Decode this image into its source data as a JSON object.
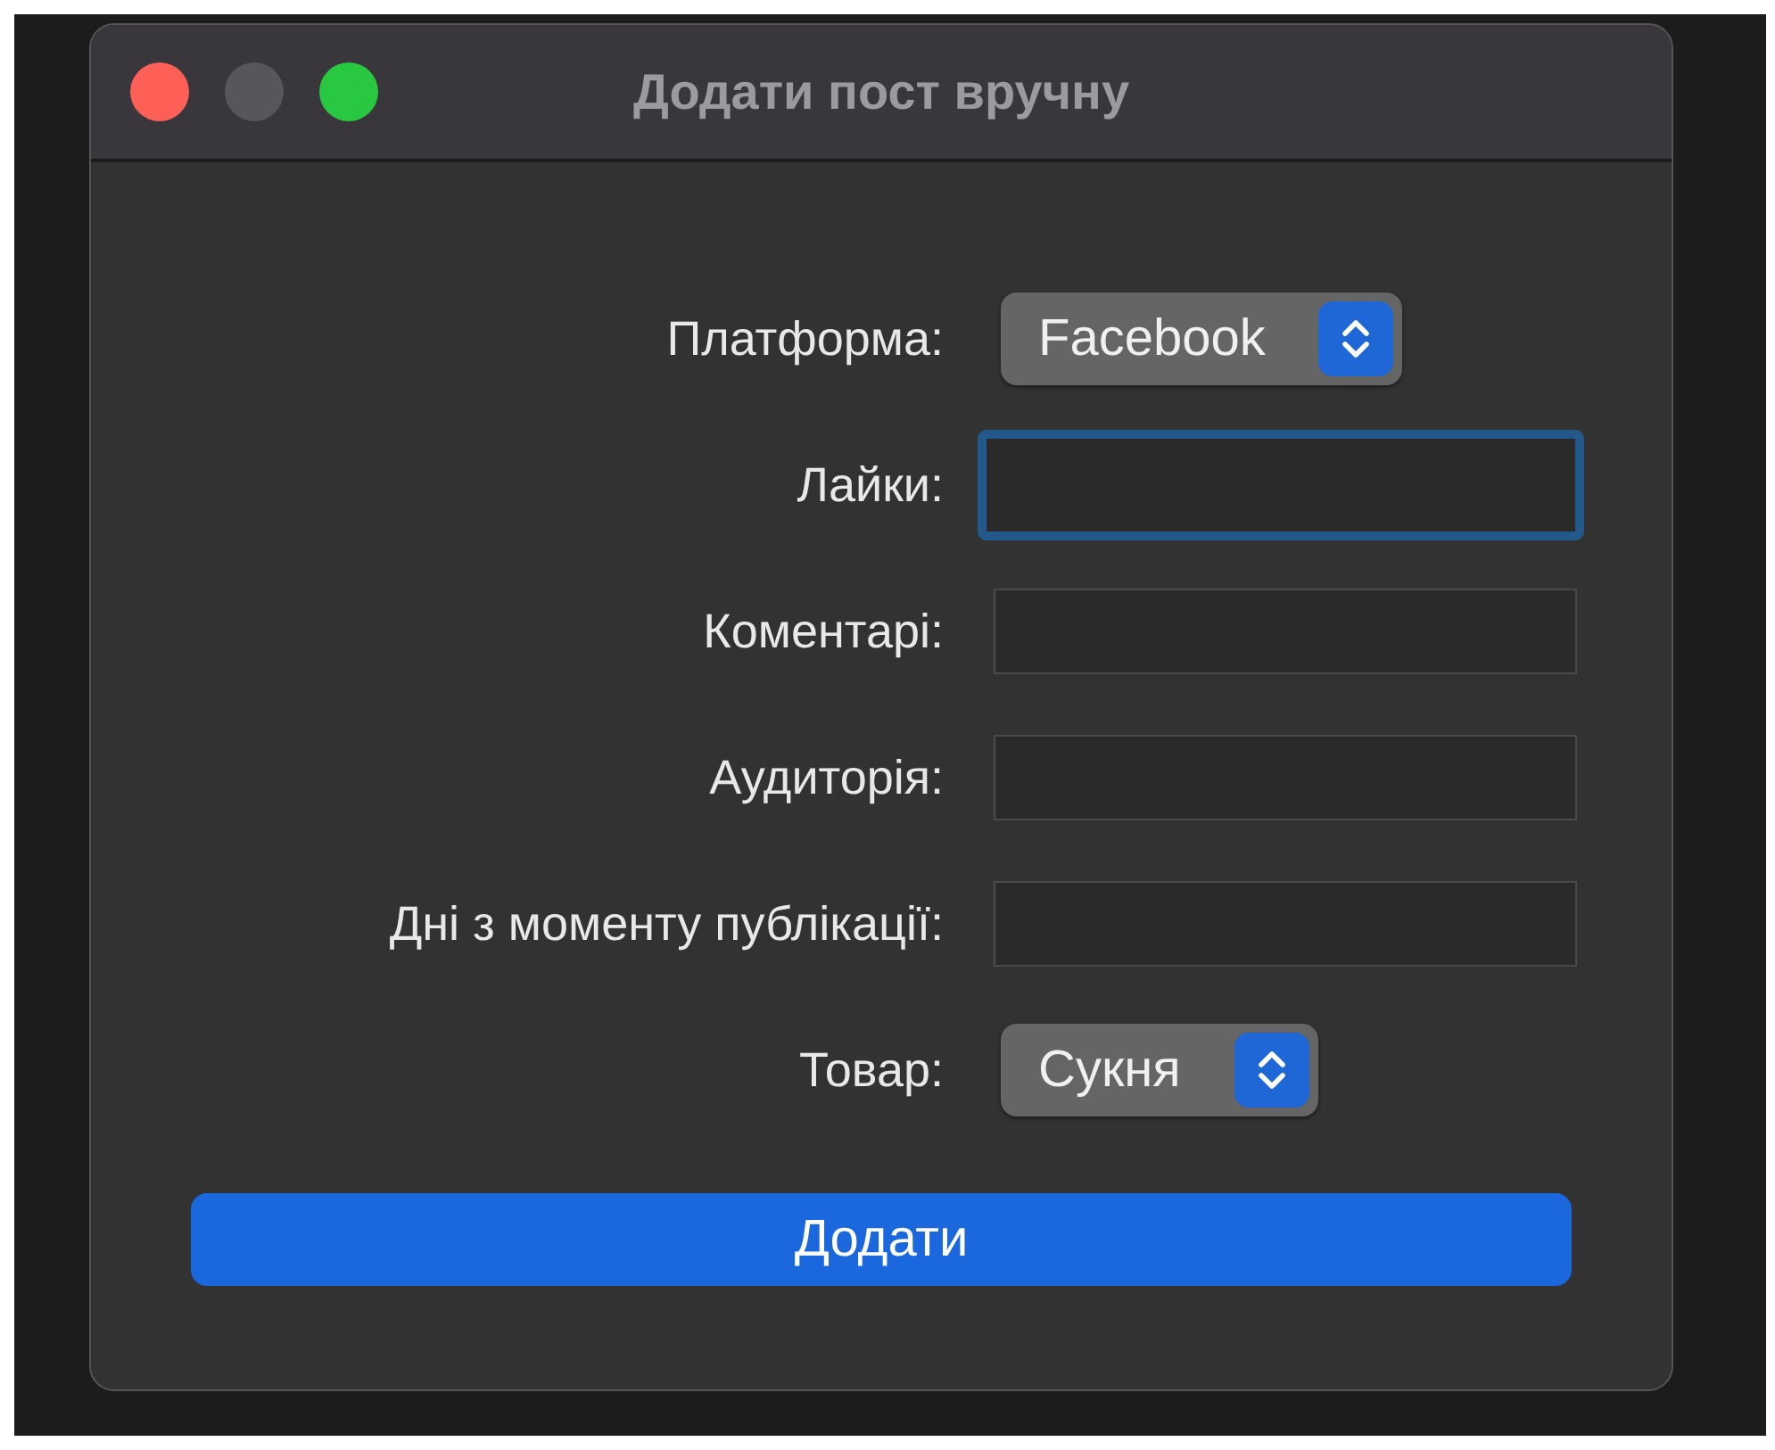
{
  "window": {
    "title": "Додати пост вручну"
  },
  "fields": [
    {
      "kind": "popup",
      "label": "Платформа:",
      "value": "Facebook"
    },
    {
      "kind": "text",
      "label": "Лайки:",
      "focused": true
    },
    {
      "kind": "text",
      "label": "Коментарі:",
      "focused": false
    },
    {
      "kind": "text",
      "label": "Аудиторія:",
      "focused": false
    },
    {
      "kind": "text",
      "label": "Дні з моменту публікації:",
      "focused": false
    },
    {
      "kind": "popup",
      "label": "Товар:",
      "value": "Сукня"
    }
  ],
  "button": "Додати"
}
